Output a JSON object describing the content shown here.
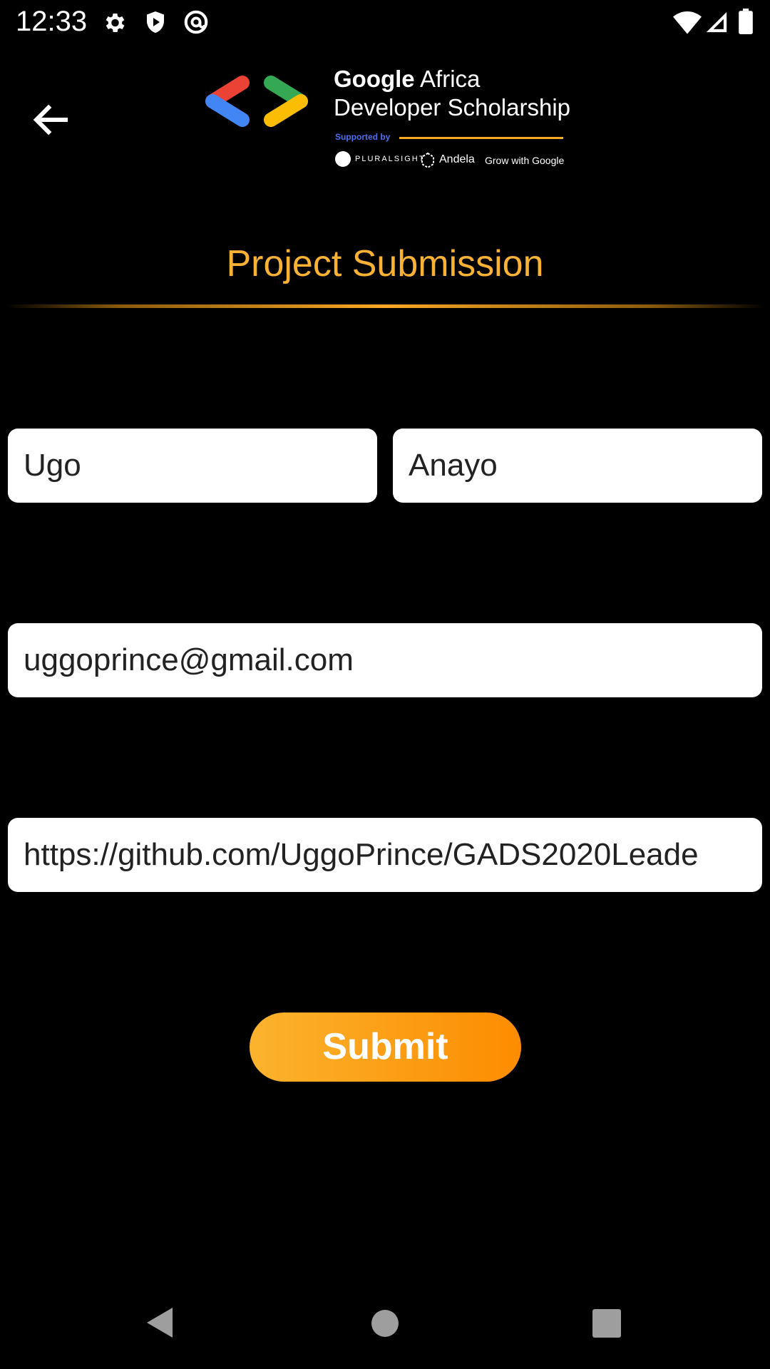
{
  "status_bar": {
    "time": "12:33",
    "icons": [
      "settings-icon",
      "shield-icon",
      "at-sign-icon",
      "wifi-icon",
      "cell-signal-icon",
      "battery-icon"
    ]
  },
  "toolbar": {
    "back_icon": "arrow-left-icon",
    "logo": {
      "brand_bold": "Google",
      "brand_rest": " Africa",
      "line2": "Developer Scholarship",
      "supported_by": "Supported by",
      "sponsor_1": "PLURALSIGHT",
      "sponsor_2": "Andela",
      "sponsor_3": "Grow with Google"
    }
  },
  "page": {
    "title": "Project Submission"
  },
  "form": {
    "first_name": "Ugo",
    "last_name": "Anayo",
    "email": "uggoprince@gmail.com",
    "project_link": "https://github.com/UggoPrince/GADS2020Leade",
    "submit_label": "Submit"
  },
  "nav_bar": {
    "icons": [
      "back-triangle-icon",
      "home-circle-icon",
      "recents-square-icon"
    ]
  },
  "colors": {
    "accent": "#f9b233",
    "button_start": "#fbb32e",
    "button_end": "#fd8c00",
    "background": "#000000"
  }
}
